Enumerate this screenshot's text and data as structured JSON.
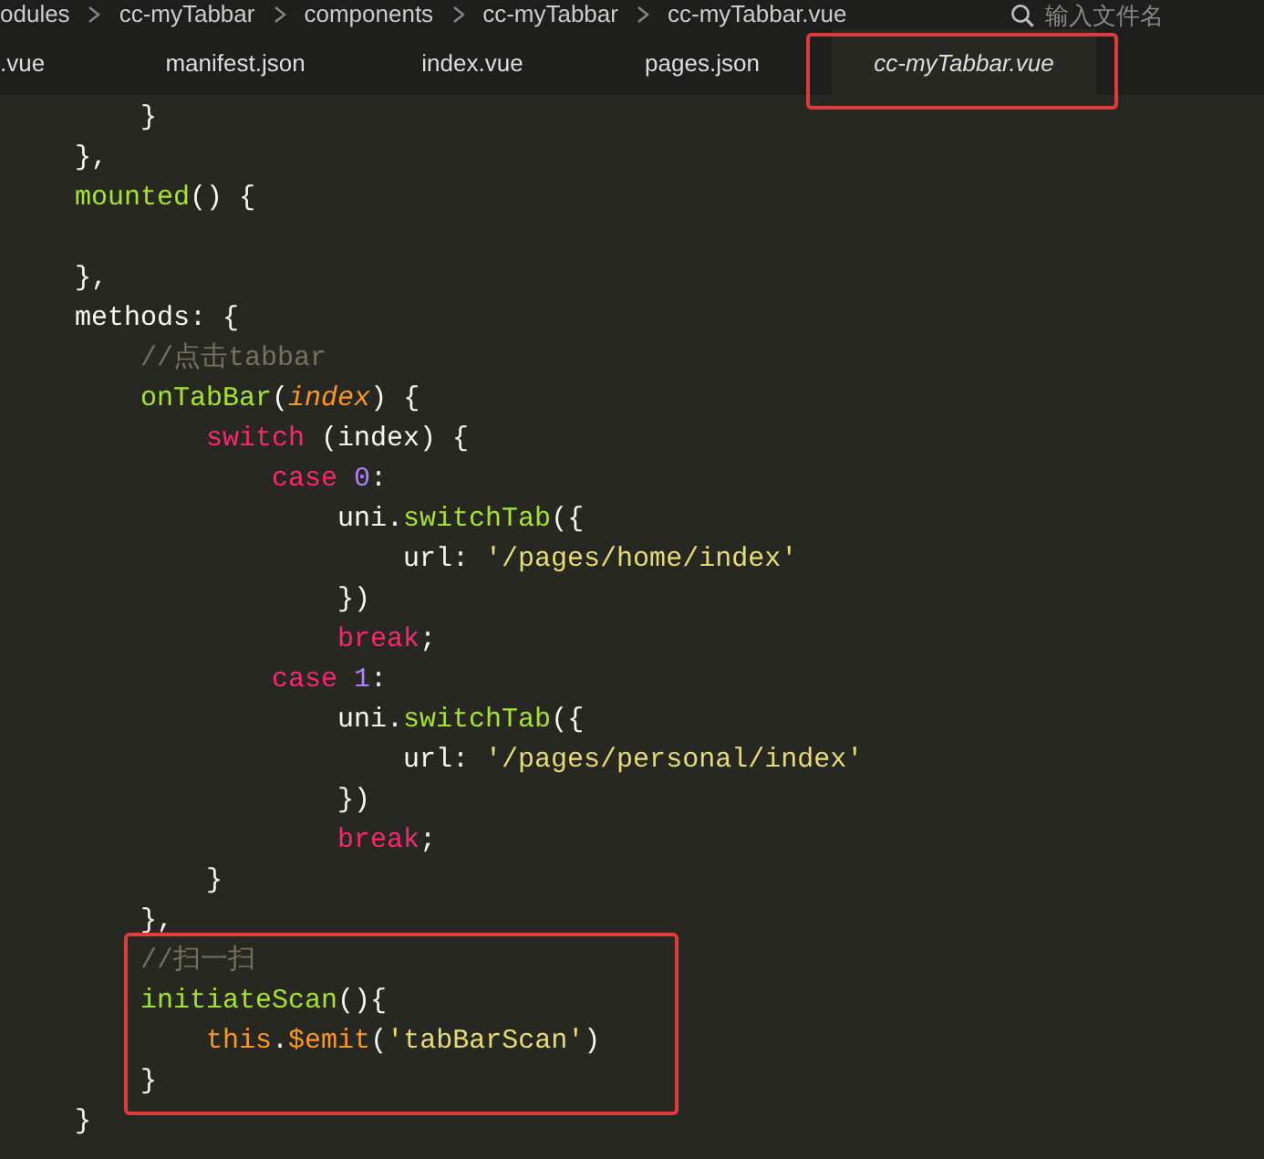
{
  "breadcrumb": {
    "items": [
      "odules",
      "cc-myTabbar",
      "components",
      "cc-myTabbar",
      "cc-myTabbar.vue"
    ],
    "search": {
      "placeholder": "输入文件名"
    }
  },
  "tabs": [
    {
      "label": ".vue",
      "selected": false,
      "highlighted": false
    },
    {
      "label": "manifest.json",
      "selected": false,
      "highlighted": false
    },
    {
      "label": "index.vue",
      "selected": false,
      "highlighted": false
    },
    {
      "label": "pages.json",
      "selected": false,
      "highlighted": false
    },
    {
      "label": "cc-myTabbar.vue",
      "selected": true,
      "highlighted": true
    }
  ],
  "code": {
    "lines": [
      {
        "tokens": [
          {
            "kind": "plain",
            "text": "        }"
          }
        ],
        "highlighted": false
      },
      {
        "tokens": [
          {
            "kind": "plain",
            "text": "    },"
          }
        ],
        "highlighted": false
      },
      {
        "tokens": [
          {
            "kind": "function",
            "text": "    mounted"
          },
          {
            "kind": "plain",
            "text": "() {"
          }
        ],
        "highlighted": false
      },
      {
        "highlighted": false
      },
      {
        "tokens": [
          {
            "kind": "plain",
            "text": "    },"
          }
        ],
        "highlighted": false
      },
      {
        "tokens": [
          {
            "kind": "plain",
            "text": "    methods: {"
          }
        ],
        "highlighted": false
      },
      {
        "tokens": [
          {
            "kind": "comment",
            "text": "        //点击tabbar"
          }
        ],
        "highlighted": false
      },
      {
        "tokens": [
          {
            "kind": "function",
            "text": "        onTabBar"
          },
          {
            "kind": "plain",
            "text": "("
          },
          {
            "kind": "param",
            "text": "index"
          },
          {
            "kind": "plain",
            "text": ") {"
          }
        ],
        "highlighted": false
      },
      {
        "tokens": [
          {
            "kind": "keyword",
            "text": "            switch"
          },
          {
            "kind": "plain",
            "text": " (index) {"
          }
        ],
        "highlighted": false
      },
      {
        "tokens": [
          {
            "kind": "keyword",
            "text": "                case"
          },
          {
            "kind": "number",
            "text": " 0"
          },
          {
            "kind": "plain",
            "text": ":"
          }
        ],
        "highlighted": false
      },
      {
        "tokens": [
          {
            "kind": "plain",
            "text": "                    uni."
          },
          {
            "kind": "function",
            "text": "switchTab"
          },
          {
            "kind": "plain",
            "text": "({"
          }
        ],
        "highlighted": false
      },
      {
        "tokens": [
          {
            "kind": "plain",
            "text": "                        url: "
          },
          {
            "kind": "string",
            "text": "'/pages/home/index'"
          }
        ],
        "highlighted": false
      },
      {
        "tokens": [
          {
            "kind": "plain",
            "text": "                    })"
          }
        ],
        "highlighted": false
      },
      {
        "tokens": [
          {
            "kind": "keyword",
            "text": "                    break"
          },
          {
            "kind": "plain",
            "text": ";"
          }
        ],
        "highlighted": false
      },
      {
        "tokens": [
          {
            "kind": "keyword",
            "text": "                case"
          },
          {
            "kind": "number",
            "text": " 1"
          },
          {
            "kind": "plain",
            "text": ":"
          }
        ],
        "highlighted": false
      },
      {
        "tokens": [
          {
            "kind": "plain",
            "text": "                    uni."
          },
          {
            "kind": "function",
            "text": "switchTab"
          },
          {
            "kind": "plain",
            "text": "({"
          }
        ],
        "highlighted": false
      },
      {
        "tokens": [
          {
            "kind": "plain",
            "text": "                        url: "
          },
          {
            "kind": "string",
            "text": "'/pages/personal/index'"
          }
        ],
        "highlighted": false
      },
      {
        "tokens": [
          {
            "kind": "plain",
            "text": "                    })"
          }
        ],
        "highlighted": false
      },
      {
        "tokens": [
          {
            "kind": "keyword",
            "text": "                    break"
          },
          {
            "kind": "plain",
            "text": ";"
          }
        ],
        "highlighted": false
      },
      {
        "tokens": [
          {
            "kind": "plain",
            "text": "            }"
          }
        ],
        "highlighted": false
      },
      {
        "tokens": [
          {
            "kind": "plain",
            "text": "        },"
          }
        ],
        "highlighted": false
      },
      {
        "tokens": [
          {
            "kind": "comment",
            "text": "        //扫一扫"
          }
        ],
        "highlighted": true
      },
      {
        "tokens": [
          {
            "kind": "function",
            "text": "        initiateScan"
          },
          {
            "kind": "plain",
            "text": "(){"
          }
        ],
        "highlighted": true
      },
      {
        "tokens": [
          {
            "kind": "this",
            "text": "            this"
          },
          {
            "kind": "plain",
            "text": "."
          },
          {
            "kind": "this",
            "text": "$emit"
          },
          {
            "kind": "plain",
            "text": "("
          },
          {
            "kind": "string",
            "text": "'tabBarScan'"
          },
          {
            "kind": "plain",
            "text": ")"
          }
        ],
        "highlighted": true
      },
      {
        "tokens": [
          {
            "kind": "plain",
            "text": "        }"
          }
        ],
        "highlighted": true
      },
      {
        "tokens": [
          {
            "kind": "plain",
            "text": "    }"
          }
        ],
        "highlighted": false
      }
    ]
  }
}
